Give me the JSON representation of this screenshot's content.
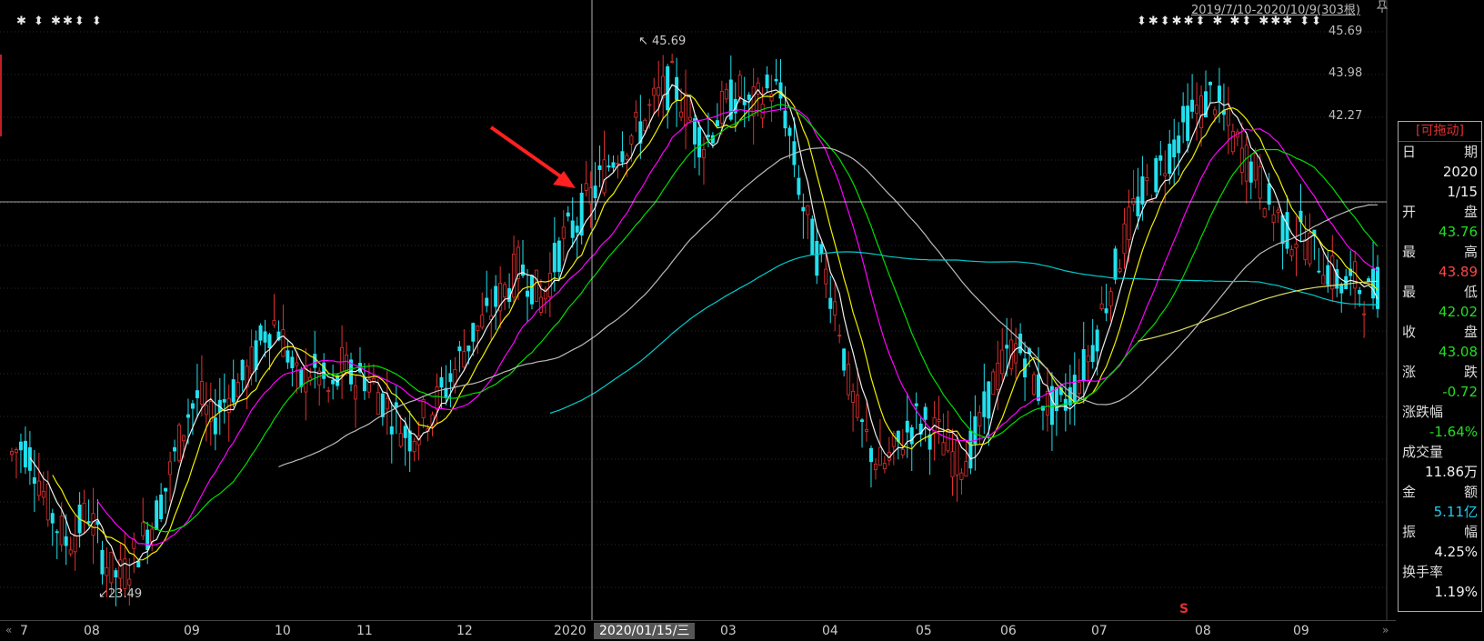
{
  "header": {
    "range": "2019/7/10-2020/10/9(303根)",
    "marks_left": "✱ ⬍ ✱✱⬍    ⬍",
    "marks_right": "⬍✱⬍✱✱⬍   ✱ ✱⬍ ✱✱✱ ⬍⬍"
  },
  "icons": {
    "pin": "pin-icon",
    "nav_left": "double-left-arrow-icon",
    "nav_right": "double-right-arrow-icon"
  },
  "price_axis": [
    "45.69",
    "43.98",
    "42.27"
  ],
  "x_axis": {
    "ticks": [
      "7",
      "08",
      "09",
      "10",
      "11",
      "12",
      "2020",
      "03",
      "04",
      "05",
      "06",
      "07",
      "08",
      "09"
    ],
    "cursor_date": "2020/01/15/三"
  },
  "annotations": {
    "high": "45.69",
    "low": "23.49",
    "marker": "S"
  },
  "data_window": {
    "title": "[可拖动]",
    "date_label": [
      "日",
      "期"
    ],
    "date_year": "2020",
    "date_md": "1/15",
    "open_label": [
      "开",
      "盘"
    ],
    "open": "43.76",
    "high_label": [
      "最",
      "高"
    ],
    "high": "43.89",
    "low_label": [
      "最",
      "低"
    ],
    "low": "42.02",
    "close_label": [
      "收",
      "盘"
    ],
    "close": "43.08",
    "change_label": [
      "涨",
      "跌"
    ],
    "change": "-0.72",
    "pct_label": "涨跌幅",
    "pct": "-1.64%",
    "volume_label": "成交量",
    "volume": "11.86万",
    "amount_label": [
      "金",
      "额"
    ],
    "amount": "5.11亿",
    "amplitude_label": [
      "振",
      "幅"
    ],
    "amplitude": "4.25%",
    "turnover_label": "换手率",
    "turnover": "1.19%"
  },
  "colors": {
    "up": "#e03030",
    "down": "#22e0ee",
    "ma5": "#f0f0f0",
    "ma10": "#f0f000",
    "ma20": "#ff00ff",
    "ma30": "#00dd00",
    "ma60": "#bbbbbb",
    "ma120": "#00cccc",
    "ma250": "#dddd66",
    "arrow": "#ff2020"
  },
  "chart_data": {
    "type": "candlestick",
    "period": "2019/7/10-2020/10/9",
    "price_high": 45.69,
    "price_low": 23.49,
    "closes": [
      28.8,
      29.2,
      28.5,
      27.0,
      26.0,
      25.2,
      25.8,
      26.5,
      25.0,
      24.0,
      23.8,
      24.6,
      25.5,
      26.2,
      27.5,
      29.0,
      30.5,
      31.2,
      30.0,
      30.8,
      31.5,
      31.8,
      32.6,
      33.8,
      34.2,
      33.0,
      31.5,
      32.2,
      32.0,
      31.0,
      32.4,
      31.8,
      32.0,
      31.5,
      30.8,
      30.2,
      29.5,
      30.0,
      30.6,
      31.2,
      32.0,
      33.0,
      33.8,
      34.2,
      35.0,
      35.6,
      36.4,
      36.0,
      35.0,
      36.2,
      37.5,
      38.0,
      38.8,
      39.6,
      40.4,
      41.2,
      41.6,
      42.0,
      42.8,
      43.4,
      43.9,
      43.0,
      42.0,
      41.4,
      42.5,
      43.0,
      43.5,
      42.8,
      43.2,
      43.8,
      43.1,
      40.8,
      38.5,
      37.0,
      36.0,
      34.5,
      31.5,
      30.0,
      29.0,
      28.2,
      28.8,
      29.5,
      30.2,
      30.0,
      29.6,
      29.0,
      28.4,
      29.0,
      30.0,
      31.6,
      32.4,
      33.2,
      32.8,
      31.6,
      30.8,
      30.6,
      31.2,
      32.0,
      33.0,
      34.6,
      36.0,
      37.5,
      38.8,
      39.5,
      40.2,
      41.0,
      41.8,
      42.6,
      42.8,
      43.5,
      42.5,
      41.5,
      40.8,
      40.2,
      39.0,
      38.4,
      37.6,
      37.8,
      37.2,
      36.6,
      36.0,
      35.6,
      35.8,
      35.2,
      35.6
    ],
    "ma_periods": [
      5,
      10,
      20,
      30,
      60,
      120,
      250
    ]
  }
}
